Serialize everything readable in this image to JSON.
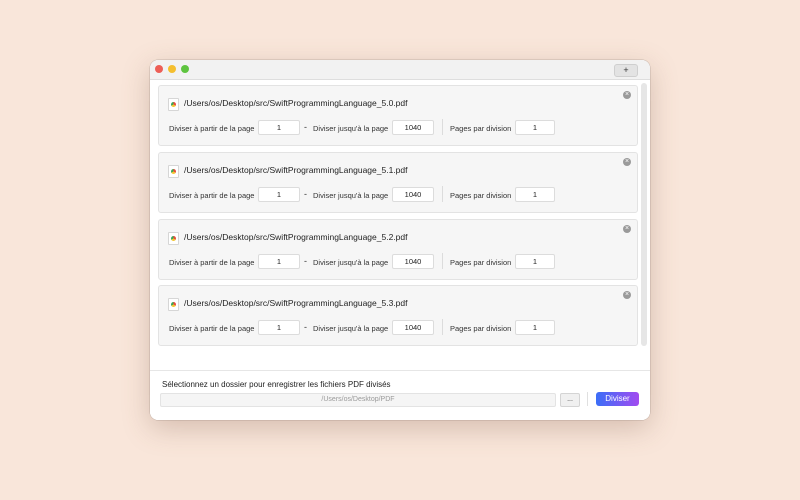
{
  "window": {
    "add_button_label": "+"
  },
  "files": [
    {
      "path": "/Users/os/Desktop/src/SwiftProgrammingLanguage_5.0.pdf",
      "from_label": "Diviser à partir de la page",
      "from_value": "1",
      "dash": "-",
      "to_label": "Diviser jusqu'à la page",
      "to_value": "1040",
      "per_label": "Pages par division",
      "per_value": "1"
    },
    {
      "path": "/Users/os/Desktop/src/SwiftProgrammingLanguage_5.1.pdf",
      "from_label": "Diviser à partir de la page",
      "from_value": "1",
      "dash": "-",
      "to_label": "Diviser jusqu'à la page",
      "to_value": "1040",
      "per_label": "Pages par division",
      "per_value": "1"
    },
    {
      "path": "/Users/os/Desktop/src/SwiftProgrammingLanguage_5.2.pdf",
      "from_label": "Diviser à partir de la page",
      "from_value": "1",
      "dash": "-",
      "to_label": "Diviser jusqu'à la page",
      "to_value": "1040",
      "per_label": "Pages par division",
      "per_value": "1"
    },
    {
      "path": "/Users/os/Desktop/src/SwiftProgrammingLanguage_5.3.pdf",
      "from_label": "Diviser à partir de la page",
      "from_value": "1",
      "dash": "-",
      "to_label": "Diviser jusqu'à la page",
      "to_value": "1040",
      "per_label": "Pages par division",
      "per_value": "1"
    }
  ],
  "output": {
    "title": "Sélectionnez un dossier pour enregistrer les fichiers PDF divisés",
    "folder_path": "/Users/os/Desktop/PDF",
    "browse_label": "...",
    "split_label": "Diviser"
  },
  "colors": {
    "background": "#f9e6da",
    "split_gradient_start": "#3b6ef7",
    "split_gradient_end": "#a24bf0"
  }
}
